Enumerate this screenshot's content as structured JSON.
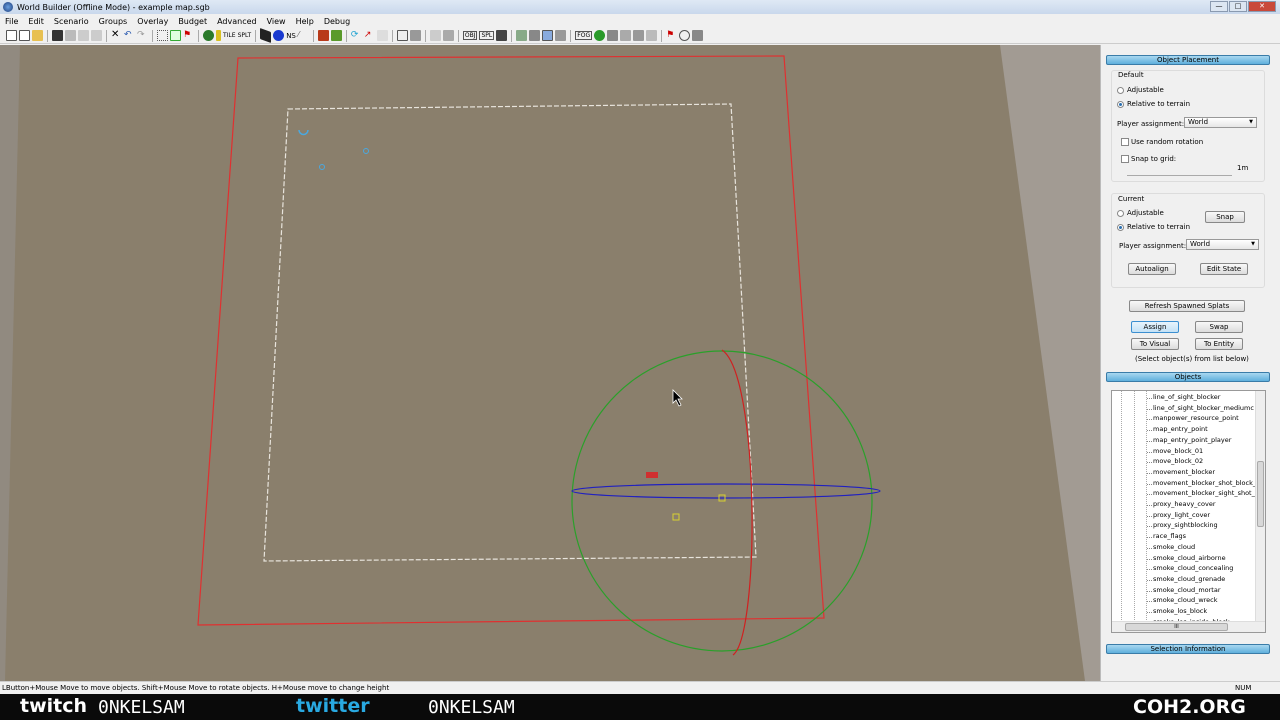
{
  "window": {
    "title": "World Builder (Offline Mode) - example map.sgb"
  },
  "menu": [
    "File",
    "Edit",
    "Scenario",
    "Groups",
    "Overlay",
    "Budget",
    "Advanced",
    "View",
    "Help",
    "Debug"
  ],
  "toolbar_text": {
    "tile": "TILE",
    "splat": "SPLT",
    "ns": "NS",
    "obj": "OBJ",
    "spl": "SPL",
    "fog": "FOG"
  },
  "panel": {
    "object_placement": "Object Placement",
    "default": {
      "title": "Default",
      "adjustable": "Adjustable",
      "relative": "Relative to terrain",
      "player_label": "Player assignment:",
      "player_value": "World",
      "random_rotation": "Use random rotation",
      "snap_grid": "Snap to grid:",
      "grid_value": "1m"
    },
    "current": {
      "title": "Current",
      "adjustable": "Adjustable",
      "relative": "Relative to terrain",
      "snap": "Snap",
      "player_label": "Player assignment:",
      "player_value": "World",
      "autoalign": "Autoalign",
      "edit_state": "Edit State"
    },
    "refresh": "Refresh Spawned Splats",
    "assign": "Assign",
    "swap": "Swap",
    "to_visual": "To Visual",
    "to_entity": "To Entity",
    "hint": "(Select object(s) from list below)",
    "objects": "Objects",
    "object_list": [
      "line_of_sight_blocker",
      "line_of_sight_blocker_mediumc",
      "manpower_resource_point",
      "map_entry_point",
      "map_entry_point_player",
      "move_block_01",
      "move_block_02",
      "movement_blocker",
      "movement_blocker_shot_block_",
      "movement_blocker_sight_shot_",
      "proxy_heavy_cover",
      "proxy_light_cover",
      "proxy_sightblocking",
      "race_flags",
      "smoke_cloud",
      "smoke_cloud_airborne",
      "smoke_cloud_concealing",
      "smoke_cloud_grenade",
      "smoke_cloud_mortar",
      "smoke_cloud_wreck",
      "smoke_los_block",
      "smoke_los_inside_block"
    ],
    "selection_info": "Selection Information",
    "scroll_thumb": "III"
  },
  "status": {
    "hint": "LButton+Mouse Move to move objects. Shift+Mouse Move to rotate objects. H+Mouse move to change height",
    "num": "NUM"
  },
  "banner": {
    "twitch": "twitch",
    "twitch_user": "0NKELSAM",
    "twitter": "twitter",
    "twitter_user": "0NKELSAM",
    "site": "COH2.ORG"
  }
}
